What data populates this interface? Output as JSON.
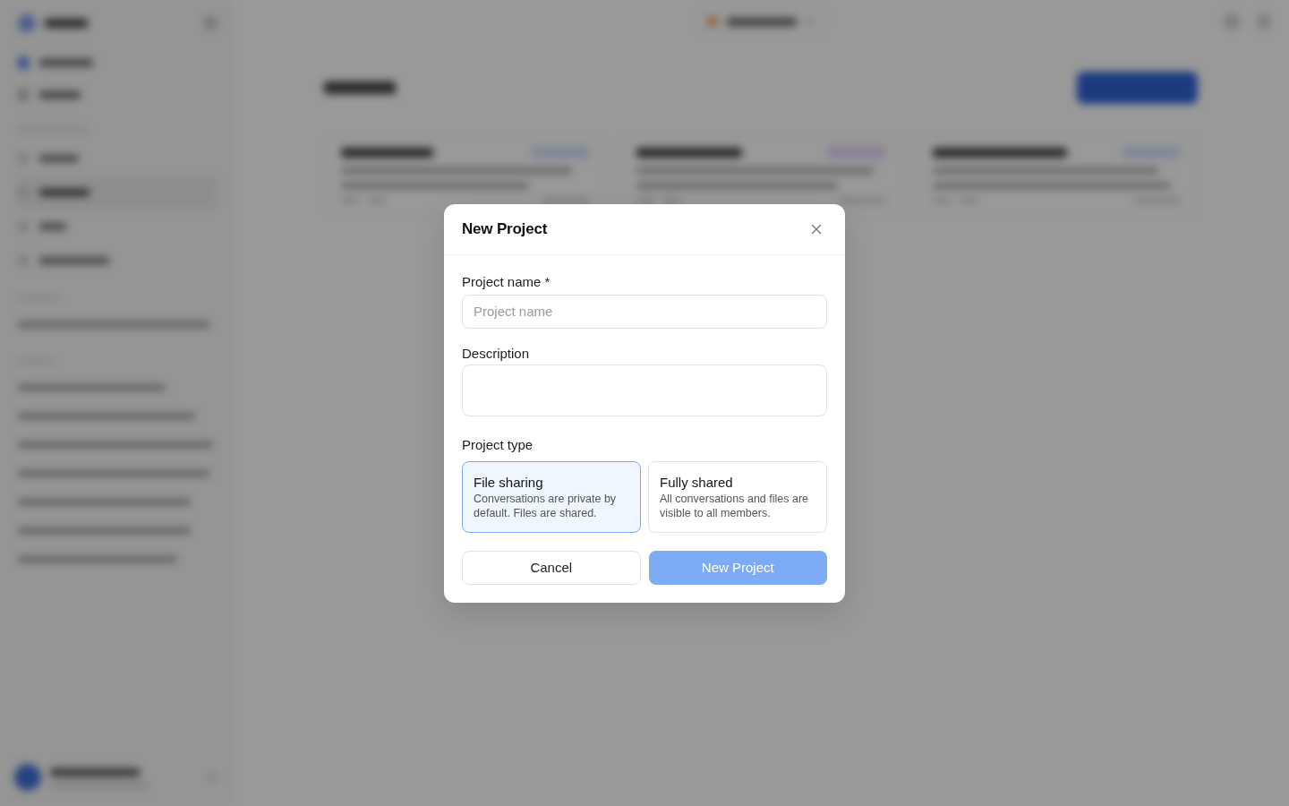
{
  "dialog": {
    "title": "New Project",
    "fields": [
      {
        "kind": "input",
        "label": "Project name *",
        "placeholder": "Project name"
      },
      {
        "kind": "textarea",
        "label": "Description"
      }
    ],
    "project_type": {
      "label": "Project type",
      "options": [
        {
          "title": "File sharing",
          "description": "Conversations are private by default. Files are shared.",
          "selected": true
        },
        {
          "title": "Fully shared",
          "description": "All conversations and files are visible to all members.",
          "selected": false
        }
      ]
    },
    "buttons": [
      {
        "kind": "secondary",
        "label": "Cancel",
        "disabled": false
      },
      {
        "kind": "primary",
        "label": "New Project",
        "disabled": true
      }
    ]
  }
}
